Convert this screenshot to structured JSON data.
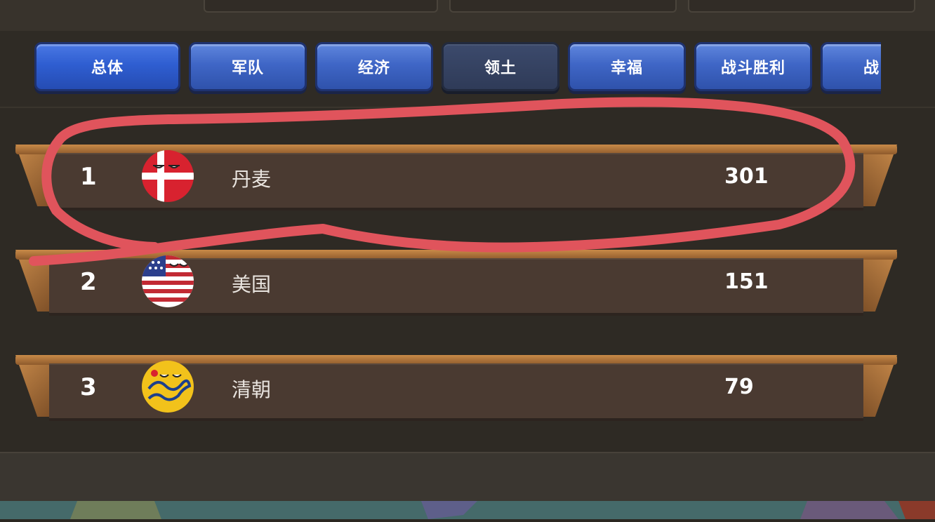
{
  "tabs": [
    {
      "label": "总体",
      "selected": false
    },
    {
      "label": "军队",
      "selected": false
    },
    {
      "label": "经济",
      "selected": false
    },
    {
      "label": "领土",
      "selected": true
    },
    {
      "label": "幸福",
      "selected": false
    },
    {
      "label": "战斗胜利",
      "selected": false
    },
    {
      "label": "战",
      "selected": false
    }
  ],
  "rankings": [
    {
      "rank": "1",
      "country": "丹麦",
      "score": "301",
      "flag": "denmark-flag-icon"
    },
    {
      "rank": "2",
      "country": "美国",
      "score": "151",
      "flag": "usa-flag-icon"
    },
    {
      "rank": "3",
      "country": "清朝",
      "score": "79",
      "flag": "qing-flag-icon"
    }
  ],
  "colors": {
    "tab_blue": "#3f66c6",
    "tab_selected": "#2f3b58",
    "row_body": "#4a3a31",
    "frame_gold": "#c98a48",
    "annotation": "#e0545c"
  }
}
